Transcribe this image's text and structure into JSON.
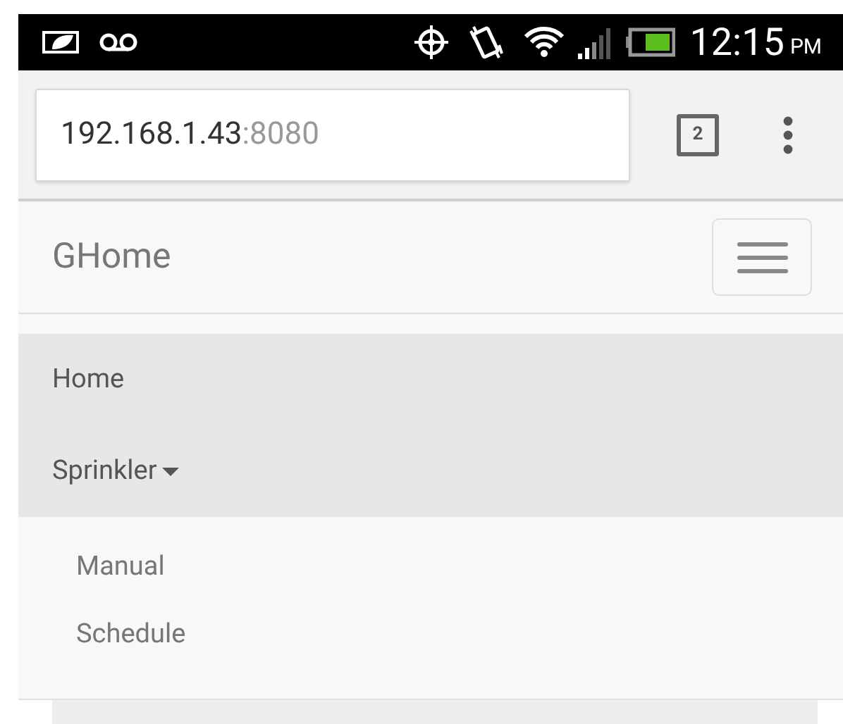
{
  "status_bar": {
    "time": "12:15",
    "meridiem": "PM"
  },
  "browser": {
    "url_host": "192.168.1.43",
    "url_port": ":8080",
    "tab_count": "2"
  },
  "navbar": {
    "brand": "GHome"
  },
  "nav": {
    "items": [
      {
        "label": "Home"
      },
      {
        "label": "Sprinkler",
        "expanded": true,
        "children": [
          {
            "label": "Manual"
          },
          {
            "label": "Schedule"
          }
        ]
      }
    ]
  }
}
